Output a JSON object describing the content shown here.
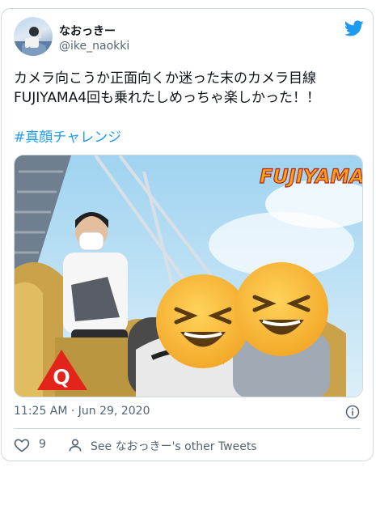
{
  "user": {
    "display_name": "なおっきー",
    "handle": "@ike_naokki"
  },
  "tweet": {
    "text": "カメラ向こうか正面向くか迷った末のカメラ目線\nFUJIYAMA4回も乗れたしめっちゃ楽しかった！！",
    "hashtag": "#真顔チャレンジ",
    "timestamp": "11:25 AM · Jun 29, 2020"
  },
  "media": {
    "logo_text": "FUJIYAMA",
    "badge_text": "Q"
  },
  "actions": {
    "like_count": "9",
    "see_other": "See なおっきー's other Tweets"
  },
  "colors": {
    "brand_blue": "#1d9bf0",
    "text_primary": "#0f1419",
    "text_secondary": "#536471",
    "border": "#cfd9de"
  },
  "icons": [
    "twitter-bird-icon",
    "info-icon",
    "heart-icon",
    "person-icon"
  ]
}
